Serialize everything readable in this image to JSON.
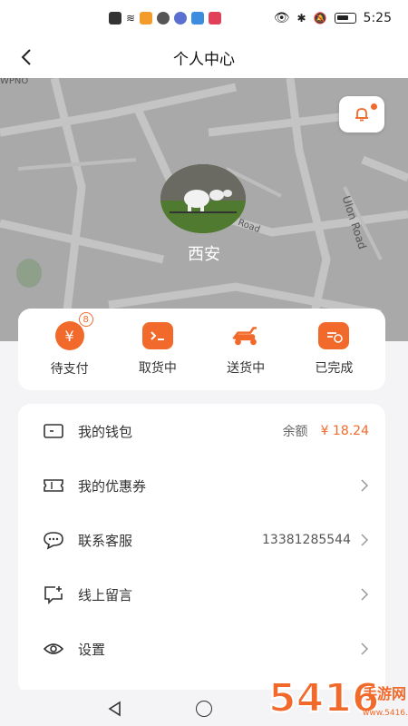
{
  "status_bar": {
    "time": "5:25"
  },
  "header": {
    "title": "个人中心"
  },
  "profile": {
    "city": "西安"
  },
  "map_labels": {
    "road": "Ulon Road",
    "road_short": "Road",
    "corner": "WPNO"
  },
  "orders": [
    {
      "label": "待支付",
      "icon": "yuan-clock-icon",
      "badge": "8"
    },
    {
      "label": "取货中",
      "icon": "pickup-box-icon"
    },
    {
      "label": "送货中",
      "icon": "scooter-icon"
    },
    {
      "label": "已完成",
      "icon": "completed-check-icon"
    }
  ],
  "menu": {
    "wallet": {
      "label": "我的钱包",
      "balance_label": "余额",
      "balance_amount": "¥ 18.24"
    },
    "coupons": {
      "label": "我的优惠券"
    },
    "support": {
      "label": "联系客服",
      "phone": "13381285544"
    },
    "message": {
      "label": "线上留言"
    },
    "settings": {
      "label": "设置"
    }
  },
  "watermark": {
    "text": "5416手游网",
    "sub": "www.5416.cn"
  },
  "colors": {
    "accent": "#f26a2b",
    "map": "#a9a9a9",
    "page_bg": "#f4f4f6"
  }
}
